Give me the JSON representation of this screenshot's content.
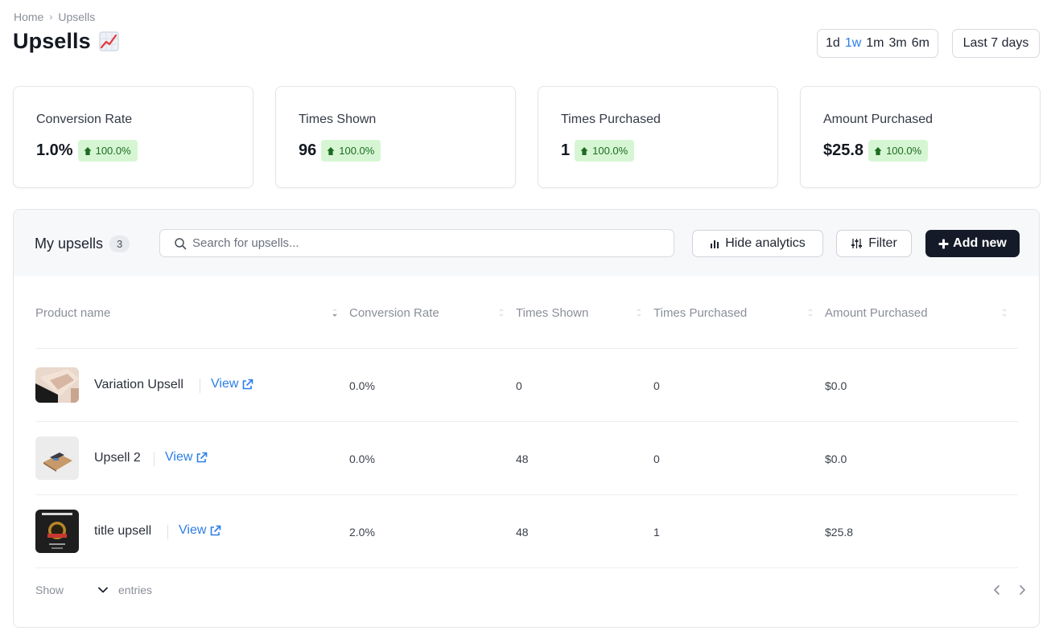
{
  "breadcrumb": {
    "home": "Home",
    "separator": "›",
    "current": "Upsells"
  },
  "page": {
    "title": "Upsells",
    "title_icon": "chart-increasing-icon"
  },
  "range": {
    "options": [
      "1d",
      "1w",
      "1m",
      "3m",
      "6m"
    ],
    "active": "1w",
    "preset_label": "Last 7 days"
  },
  "stats": [
    {
      "label": "Conversion Rate",
      "value": "1.0%",
      "change": "100.0%"
    },
    {
      "label": "Times Shown",
      "value": "96",
      "change": "100.0%"
    },
    {
      "label": "Times Purchased",
      "value": "1",
      "change": "100.0%"
    },
    {
      "label": "Amount Purchased",
      "value": "$25.8",
      "change": "100.0%"
    }
  ],
  "panel": {
    "title": "My upsells",
    "count": "3",
    "search_placeholder": "Search for upsells...",
    "hide_analytics_label": "Hide analytics",
    "filter_label": "Filter",
    "add_new_label": "Add new"
  },
  "table": {
    "columns": [
      "Product name",
      "Conversion Rate",
      "Times Shown",
      "Times Purchased",
      "Amount Purchased"
    ],
    "view_label": "View",
    "rows": [
      {
        "name": "Variation Upsell",
        "conversion": "0.0%",
        "shown": "0",
        "purchased": "0",
        "amount": "$0.0"
      },
      {
        "name": "Upsell 2",
        "conversion": "0.0%",
        "shown": "48",
        "purchased": "0",
        "amount": "$0.0"
      },
      {
        "name": "title upsell",
        "conversion": "2.0%",
        "shown": "48",
        "purchased": "1",
        "amount": "$25.8"
      }
    ]
  },
  "footer": {
    "show_label": "Show",
    "entries_label": "entries"
  },
  "colors": {
    "accent": "#2b7de9",
    "badge_bg": "#d6f6d3",
    "badge_text": "#1d6b22",
    "primary_button": "#141a28"
  }
}
